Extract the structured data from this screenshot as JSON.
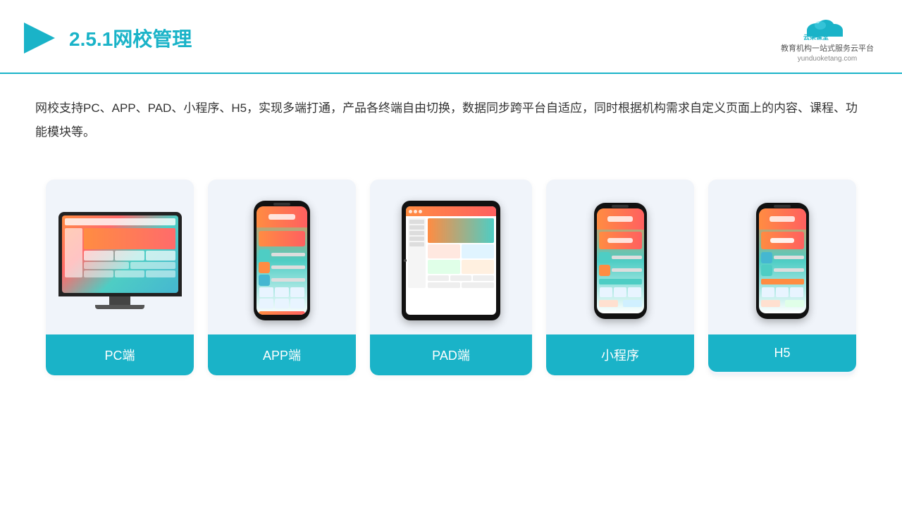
{
  "header": {
    "title_prefix": "2.5.1",
    "title_main": "网校管理",
    "logo_name": "云朵课堂",
    "logo_url": "yunduoketang.com",
    "logo_tagline": "教育机构一站式服务云平台"
  },
  "description": {
    "text": "网校支持PC、APP、PAD、小程序、H5，实现多端打通，产品各终端自由切换，数据同步跨平台自适应，同时根据机构需求自定义页面上的内容、课程、功能模块等。"
  },
  "cards": [
    {
      "id": "pc",
      "label": "PC端"
    },
    {
      "id": "app",
      "label": "APP端"
    },
    {
      "id": "pad",
      "label": "PAD端"
    },
    {
      "id": "miniapp",
      "label": "小程序"
    },
    {
      "id": "h5",
      "label": "H5"
    }
  ]
}
